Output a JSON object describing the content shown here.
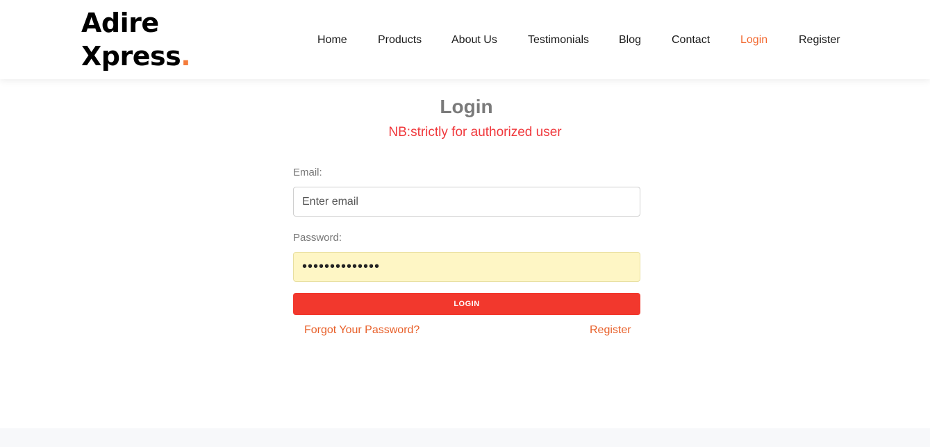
{
  "header": {
    "logo_line1": "Adire",
    "logo_line2": "Xpress",
    "logo_dot": ".",
    "nav": {
      "home": "Home",
      "products": "Products",
      "about": "About Us",
      "testimonials": "Testimonials",
      "blog": "Blog",
      "contact": "Contact",
      "login": "Login",
      "register": "Register"
    },
    "active_nav": "Login"
  },
  "form": {
    "title": "Login",
    "notice": "NB:strictly for authorized user",
    "email_label": "Email:",
    "email_placeholder": "Enter email",
    "email_value": "",
    "password_label": "Password:",
    "password_value": "••••••••••••••",
    "login_button": "LOGIN",
    "forgot_link": "Forgot Your Password?",
    "register_link": "Register"
  },
  "colors": {
    "accent": "#f2682f",
    "button": "#f2382d",
    "notice": "#f0383c",
    "autofill_bg": "#fef6c5"
  }
}
